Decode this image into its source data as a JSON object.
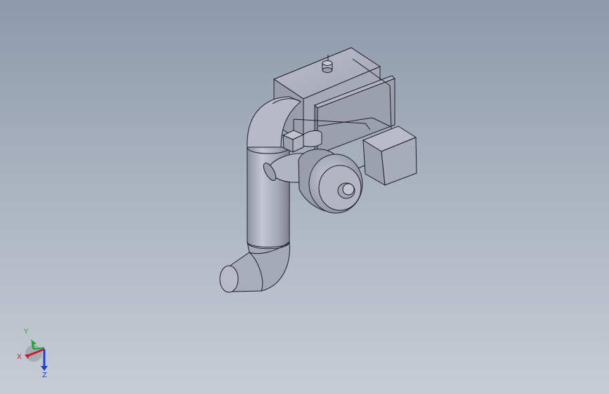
{
  "viewport": {
    "background_top": "#8d9aac",
    "background_bottom": "#c7ccd5"
  },
  "model": {
    "name": "burner-assembly",
    "parts": [
      "elbow-duct",
      "conical-inlet",
      "fan-housing",
      "motor-hub",
      "control-box",
      "junction-box",
      "small-connector",
      "gauge-knob"
    ],
    "body_color": "#a7aab8",
    "shadow_color": "#7a7d8e",
    "edge_color": "#1d1f28"
  },
  "triad": {
    "x_label": "X",
    "y_label": "Y",
    "z_label": "Z",
    "x_color": "#c8202a",
    "y_color": "#22a83a",
    "z_color": "#1f3fcf"
  }
}
